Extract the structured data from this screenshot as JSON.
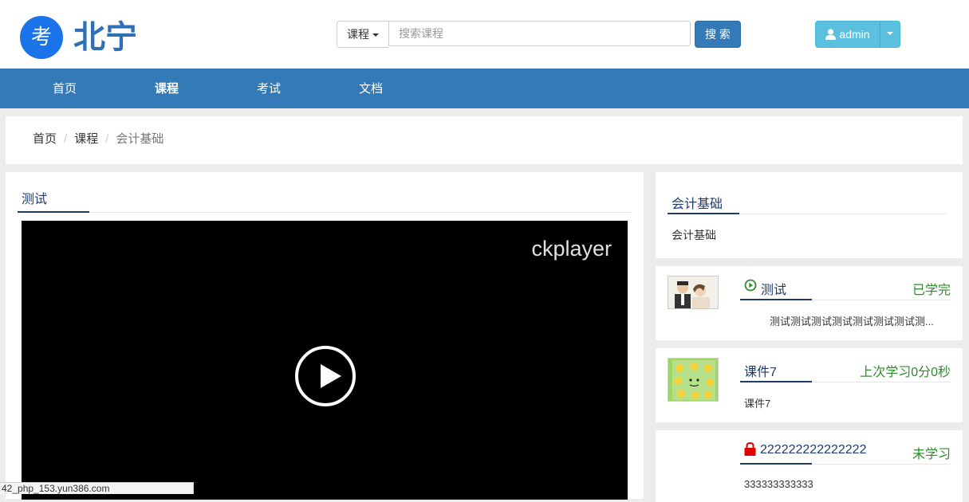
{
  "header": {
    "logo_char": "考",
    "logo_text": "北宁",
    "search": {
      "type_label": "课程",
      "placeholder": "搜索课程",
      "button_label": "搜 索"
    },
    "user": {
      "name": "admin"
    }
  },
  "nav": {
    "items": [
      {
        "label": "首页"
      },
      {
        "label": "课程",
        "active": true
      },
      {
        "label": "考试"
      },
      {
        "label": "文档"
      }
    ]
  },
  "breadcrumb": {
    "items": [
      "首页",
      "课程"
    ],
    "current": "会计基础"
  },
  "main": {
    "title": "测试",
    "player": {
      "brand": "ckplayer"
    }
  },
  "course_info": {
    "title": "会计基础",
    "description": "会计基础"
  },
  "lessons": [
    {
      "title": "测试",
      "status": "已学完",
      "description": "测试测试测试测试测试测试测试测...",
      "icon": "play-circle-icon",
      "thumb": "photo-couple"
    },
    {
      "title": "课件7",
      "status": "上次学习0分0秒",
      "description": "课件7",
      "icon": "",
      "thumb": "emoji-sheet"
    },
    {
      "title": "222222222222222",
      "status": "未学习",
      "description": "333333333333",
      "icon": "lock-icon",
      "thumb": ""
    }
  ],
  "status_bar": {
    "text": "42_php_153.yun386.com"
  },
  "colors": {
    "primary": "#337ab7",
    "info": "#5bc0de",
    "title": "#1e3a6b",
    "status_green": "#2e8b2e",
    "lock": "#e00000"
  }
}
